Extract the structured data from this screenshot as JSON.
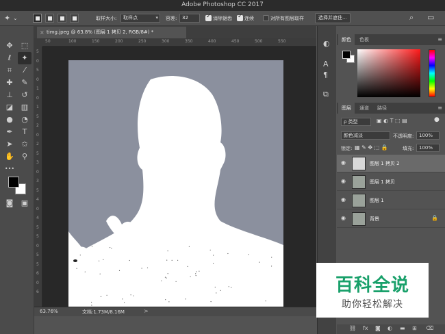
{
  "app": {
    "title": "Adobe Photoshop CC 2017"
  },
  "options_bar": {
    "sample_size_label": "取样大小:",
    "sample_size_value": "取样点",
    "tolerance_label": "容差:",
    "tolerance_value": "32",
    "antialias_label": "消除锯齿",
    "contiguous_label": "连续",
    "sample_all_label": "对所有图层取样",
    "select_mask_button": "选择并遮住..."
  },
  "document": {
    "tab_label": "timg.jpeg @ 63.8% (图层 1 拷贝 2, RGB/8#) *",
    "close_glyph": "×"
  },
  "rulers": {
    "top_ticks": [
      "50",
      "100",
      "150",
      "200",
      "250",
      "300",
      "350",
      "400",
      "450",
      "500",
      "550"
    ],
    "left_ticks": [
      "5",
      "0",
      "5",
      "0",
      "1",
      "0",
      "1",
      "5",
      "2",
      "0",
      "2",
      "5",
      "3",
      "0",
      "3",
      "5",
      "4",
      "0",
      "4",
      "5",
      "5",
      "0",
      "5",
      "5",
      "6",
      "0",
      "6"
    ]
  },
  "status_bar": {
    "zoom": "63.76%",
    "doc_size": "文档:1.73M/8.16M",
    "arrow": ">"
  },
  "color_panel": {
    "tabs": [
      "颜色",
      "色板"
    ],
    "foreground": "#000000",
    "background": "#ffffff"
  },
  "layers_panel": {
    "tabs": [
      "图层",
      "通道",
      "路径"
    ],
    "filter_label": "ρ 类型",
    "blend_mode": "颜色减淡",
    "opacity_label": "不透明度:",
    "opacity_value": "100%",
    "lock_label": "锁定:",
    "fill_label": "填充:",
    "fill_value": "100%",
    "layers": [
      {
        "name": "图层 1 拷贝 2",
        "selected": true,
        "locked": false
      },
      {
        "name": "图层 1 拷贝",
        "selected": false,
        "locked": false
      },
      {
        "name": "图层 1",
        "selected": false,
        "locked": false
      },
      {
        "name": "背景",
        "selected": false,
        "locked": true
      }
    ],
    "footer_icons": [
      "link-icon",
      "fx-icon",
      "mask-icon",
      "adjustment-icon",
      "folder-icon",
      "new-layer-icon",
      "trash-icon"
    ],
    "footer_fx": "fx"
  },
  "watermark": {
    "title": "百科全说",
    "subtitle": "助你轻松解决"
  },
  "colors": {
    "canvas_bg": "#282828",
    "image_bg": "#8b909e",
    "watermark_green": "#18a06a"
  }
}
